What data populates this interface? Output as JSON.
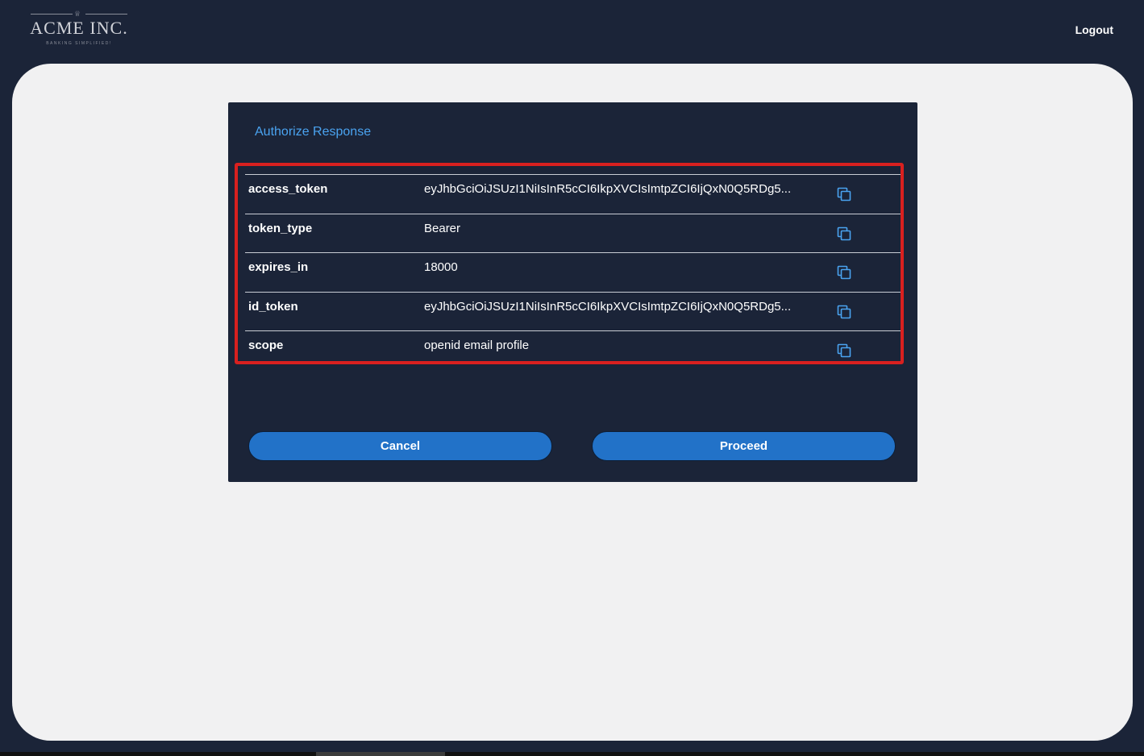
{
  "header": {
    "logo": {
      "name": "ACME INC.",
      "tagline": "BANKING SIMPLIFIED!"
    },
    "logout_label": "Logout"
  },
  "card": {
    "title": "Authorize Response",
    "rows": [
      {
        "key": "access_token",
        "value": "eyJhbGciOiJSUzI1NiIsInR5cCI6IkpXVCIsImtpZCI6IjQxN0Q5RDg5..."
      },
      {
        "key": "token_type",
        "value": "Bearer"
      },
      {
        "key": "expires_in",
        "value": "18000"
      },
      {
        "key": "id_token",
        "value": "eyJhbGciOiJSUzI1NiIsInR5cCI6IkpXVCIsImtpZCI6IjQxN0Q5RDg5..."
      },
      {
        "key": "scope",
        "value": "openid email profile"
      }
    ],
    "copy_icon": "copy-icon",
    "cancel_label": "Cancel",
    "proceed_label": "Proceed"
  },
  "colors": {
    "background": "#1b2438",
    "panel": "#f1f1f2",
    "accent": "#4aa3f0",
    "button": "#2272c8",
    "highlight": "#d9201f"
  }
}
